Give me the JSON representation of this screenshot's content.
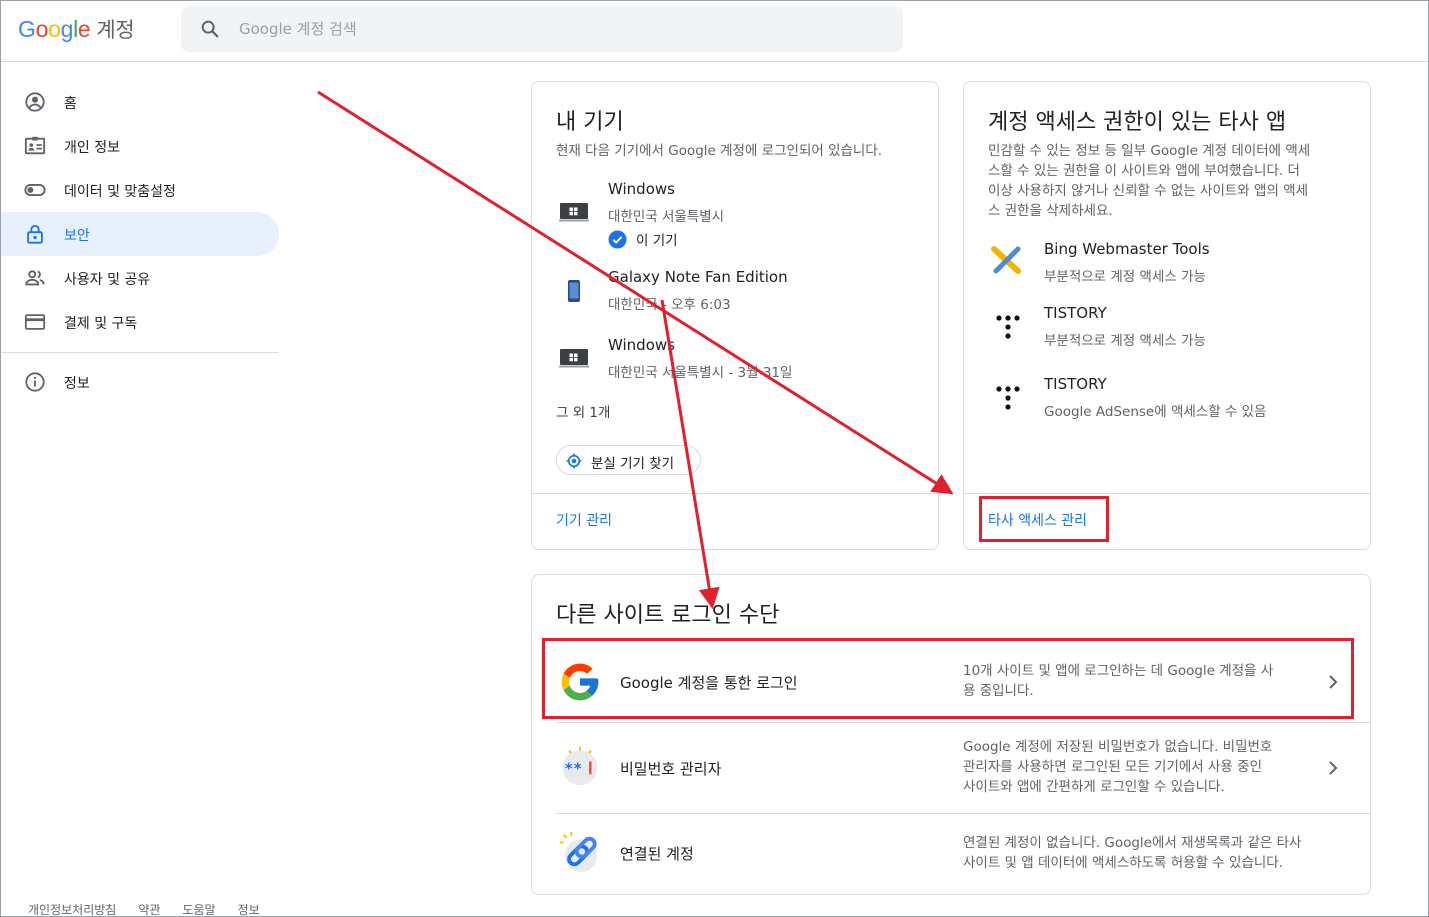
{
  "header": {
    "logo_word": "Google",
    "logo_suffix": "계정",
    "search_placeholder": "Google 계정 검색"
  },
  "sidebar": {
    "items": [
      {
        "label": "홈",
        "icon": "account-circle-icon"
      },
      {
        "label": "개인 정보",
        "icon": "id-card-icon"
      },
      {
        "label": "데이터 및 맞춤설정",
        "icon": "toggle-icon"
      },
      {
        "label": "보안",
        "icon": "lock-icon",
        "active": true
      },
      {
        "label": "사용자 및 공유",
        "icon": "people-icon"
      },
      {
        "label": "결제 및 구독",
        "icon": "credit-card-icon"
      },
      {
        "label": "정보",
        "icon": "info-icon"
      }
    ],
    "footer": [
      "개인정보처리방침",
      "약관",
      "도움말",
      "정보"
    ]
  },
  "devices_card": {
    "title": "내 기기",
    "desc": "현재 다음 기기에서 Google 계정에 로그인되어 있습니다.",
    "devices": [
      {
        "name": "Windows",
        "sub": "대한민국 서울특별시",
        "badge": "이 기기"
      },
      {
        "name": "Galaxy Note Fan Edition",
        "sub": "대한민국 - 오후 6:03"
      },
      {
        "name": "Windows",
        "sub": "대한민국 서울특별시 - 3월 31일"
      }
    ],
    "more": "그 외 1개",
    "find_lost": "분실 기기 찾기",
    "manage_link": "기기 관리"
  },
  "apps_card": {
    "title": "계정 액세스 권한이 있는 타사 앱",
    "desc_lines": [
      "민감할 수 있는 정보 등 일부 Google 계정 데이터에 액세",
      "스할 수 있는 권한을 이 사이트와 앱에 부여했습니다. 더",
      "이상 사용하지 않거나 신뢰할 수 없는 사이트와 앱의 액세",
      "스 권한을 삭제하세요."
    ],
    "apps": [
      {
        "name": "Bing Webmaster Tools",
        "sub": "부분적으로 계정 액세스 가능"
      },
      {
        "name": "TISTORY",
        "sub": "부분적으로 계정 액세스 가능"
      },
      {
        "name": "TISTORY",
        "sub": "Google AdSense에 액세스할 수 있음"
      }
    ],
    "manage_link": "타사 액세스 관리"
  },
  "signin_card": {
    "title": "다른 사이트 로그인 수단",
    "rows": [
      {
        "title": "Google 계정을 통한 로그인",
        "desc_lines": [
          "10개 사이트 및 앱에 로그인하는 데 Google 계정을 사",
          "용 중입니다."
        ]
      },
      {
        "title": "비밀번호 관리자",
        "desc_lines": [
          "Google 계정에 저장된 비밀번호가 없습니다. 비밀번호",
          "관리자를 사용하면 로그인된 모든 기기에서 사용 중인",
          "사이트와 앱에 간편하게 로그인할 수 있습니다."
        ]
      },
      {
        "title": "연결된 계정",
        "desc_lines": [
          "연결된 계정이 없습니다. Google에서 재생목록과 같은 타사",
          "사이트 및 앱 데이터에 액세스하도록 허용할 수 있습니다."
        ]
      }
    ]
  },
  "colors": {
    "accent": "#1a73e8",
    "annotation": "#e0202c",
    "active_nav_bg": "#e8f0fe"
  }
}
